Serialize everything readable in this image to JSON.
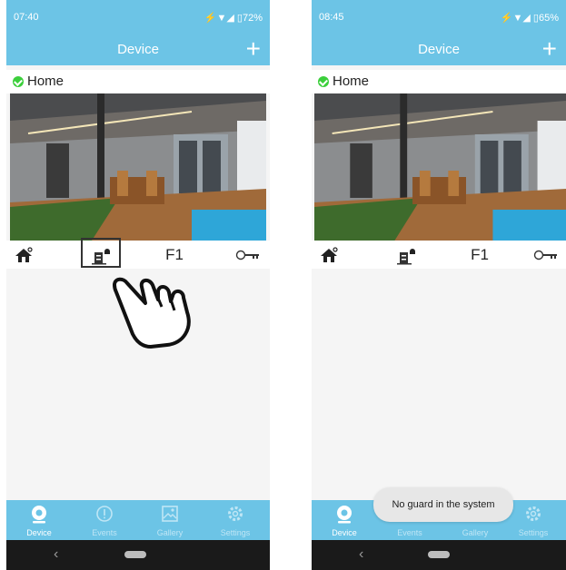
{
  "screens": [
    {
      "status": {
        "time": "07:40",
        "system": "⚡▼◢ ▯72%"
      },
      "appbar": {
        "title": "Device",
        "add": "+"
      },
      "device": {
        "name": "Home",
        "control_label": "F1"
      },
      "tabs": [
        {
          "label": "Device",
          "icon": "device-icon",
          "active": true
        },
        {
          "label": "Events",
          "icon": "events-icon",
          "active": false
        },
        {
          "label": "Gallery",
          "icon": "gallery-icon",
          "active": false
        },
        {
          "label": "Settings",
          "icon": "settings-icon",
          "active": false
        }
      ],
      "nav": {
        "back": "‹"
      }
    },
    {
      "status": {
        "time": "08:45",
        "system": "⚡▼◢ ▯65%"
      },
      "appbar": {
        "title": "Device",
        "add": "+"
      },
      "device": {
        "name": "Home",
        "control_label": "F1"
      },
      "toast": "No guard in the system",
      "tabs": [
        {
          "label": "Device",
          "icon": "device-icon",
          "active": true
        },
        {
          "label": "Events",
          "icon": "events-icon",
          "active": false
        },
        {
          "label": "Gallery",
          "icon": "gallery-icon",
          "active": false
        },
        {
          "label": "Settings",
          "icon": "settings-icon",
          "active": false
        }
      ],
      "nav": {
        "back": "‹"
      }
    }
  ],
  "colors": {
    "accent": "#6cc4e6",
    "online": "#3ccf3c",
    "navbar": "#1a1a1a"
  }
}
